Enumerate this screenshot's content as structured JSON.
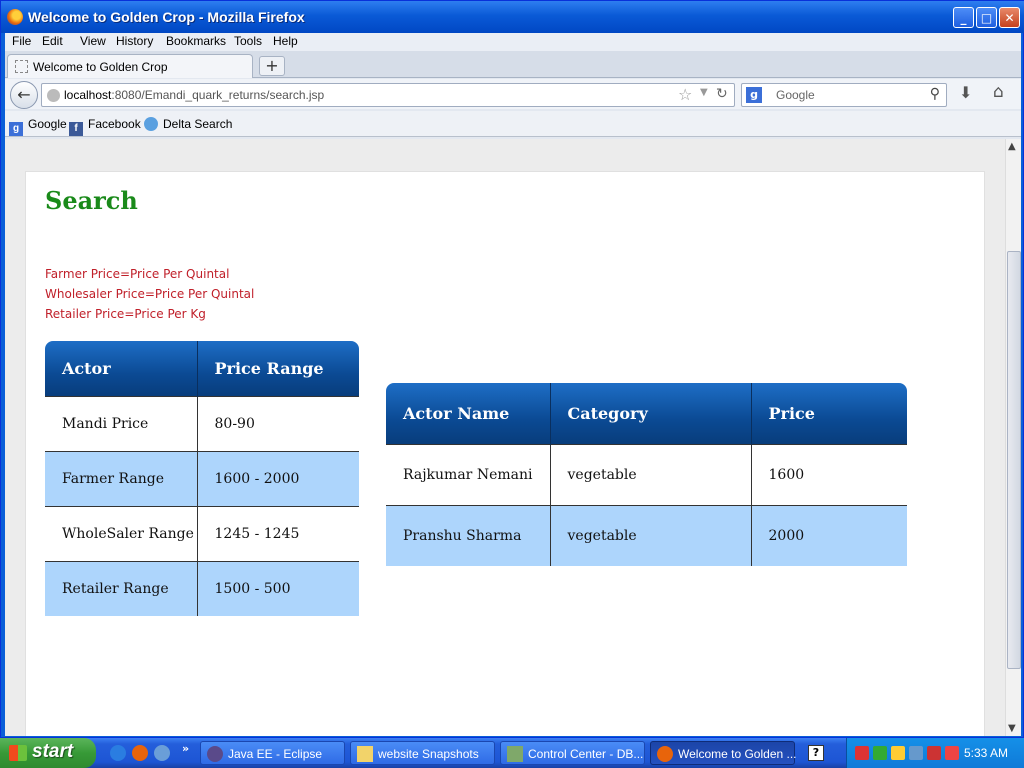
{
  "window": {
    "title": "Welcome to Golden Crop - Mozilla Firefox"
  },
  "menu": [
    "File",
    "Edit",
    "View",
    "History",
    "Bookmarks",
    "Tools",
    "Help"
  ],
  "tab": {
    "label": "Welcome to Golden Crop",
    "new_tab": "+"
  },
  "nav": {
    "url_host": "localhost",
    "url_rest": ":8080/Emandi_quark_returns/search.jsp",
    "search_placeholder": "Google"
  },
  "bookmarks": [
    {
      "label": "Google",
      "icon": "google-icon"
    },
    {
      "label": "Facebook",
      "icon": "facebook-icon"
    },
    {
      "label": "Delta Search",
      "icon": "delta-search-icon"
    }
  ],
  "page": {
    "title": "Search",
    "notes": [
      "Farmer Price=Price Per Quintal",
      "Wholesaler Price=Price Per Quintal",
      "Retailer Price=Price Per Kg"
    ],
    "price_table": {
      "headers": [
        "Actor",
        "Price Range"
      ],
      "rows": [
        [
          "Mandi Price",
          "80-90"
        ],
        [
          "Farmer Range",
          "1600 - 2000"
        ],
        [
          "WholeSaler Range",
          "1245 - 1245"
        ],
        [
          "Retailer Range",
          "1500 - 500"
        ]
      ]
    },
    "actor_table": {
      "headers": [
        "Actor Name",
        "Category",
        "Price"
      ],
      "rows": [
        [
          "Rajkumar Nemani",
          "vegetable",
          "1600"
        ],
        [
          "Pranshu Sharma",
          "vegetable",
          "2000"
        ]
      ]
    }
  },
  "taskbar": {
    "start": "start",
    "tasks": [
      {
        "label": "Java EE - Eclipse",
        "icon": "eclipse-icon"
      },
      {
        "label": "website Snapshots",
        "icon": "folder-icon"
      },
      {
        "label": "Control Center - DB...",
        "icon": "db2-icon"
      },
      {
        "label": "Welcome to Golden ...",
        "icon": "firefox-icon"
      }
    ],
    "clock": "5:33 AM"
  },
  "colors": {
    "title_green": "#1a8a1a",
    "note_red": "#c0202a",
    "table_header": "#0b4a94",
    "row_alt": "#add5fc"
  }
}
